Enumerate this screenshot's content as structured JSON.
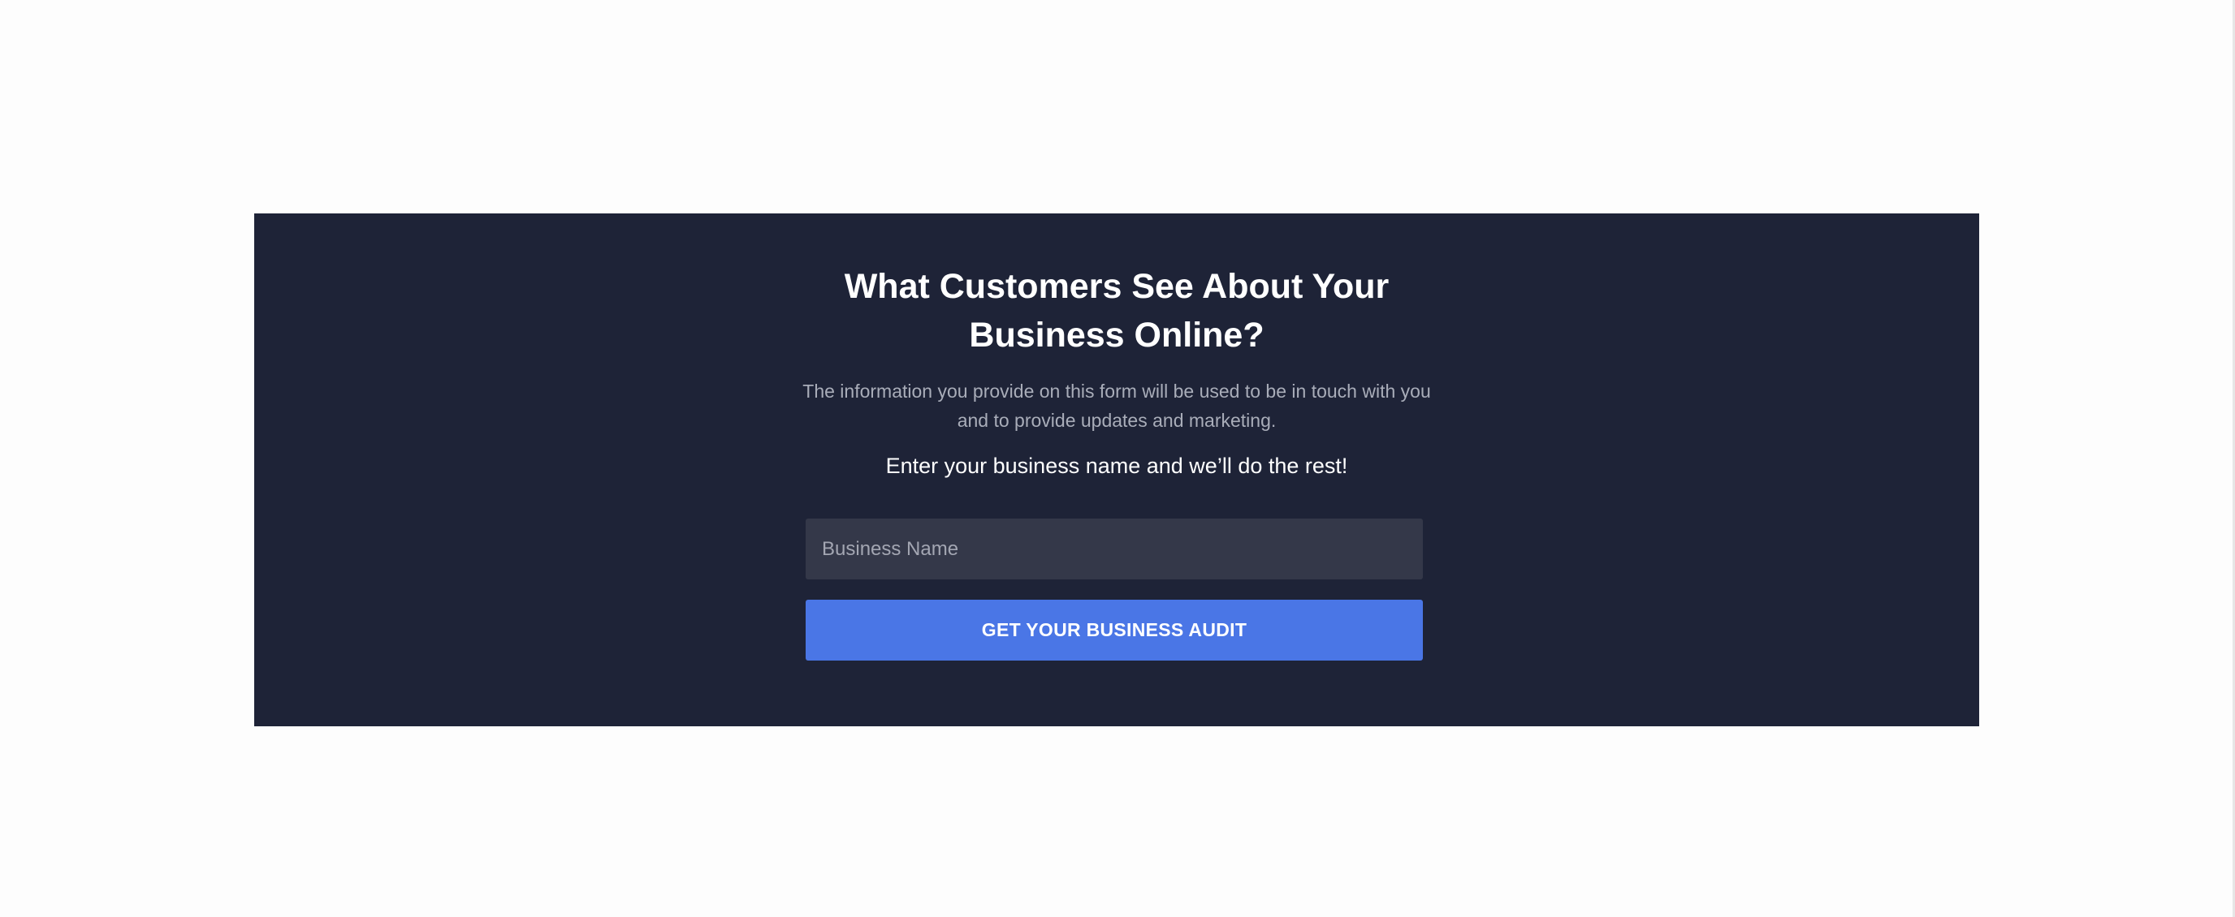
{
  "section": {
    "title": "What Customers See About Your Business Online?",
    "description": "The information you provide on this form will be used to be in touch with you and to provide updates and marketing.",
    "prompt": "Enter your business name and we’ll do the rest!"
  },
  "form": {
    "business_name": {
      "value": "",
      "placeholder": "Business Name"
    },
    "submit_label": "GET YOUR BUSINESS AUDIT"
  },
  "colors": {
    "panel_background": "#1e2337",
    "input_background": "#343849",
    "accent": "#4a76e6",
    "text_primary": "#ffffff",
    "text_muted": "#a9adb9"
  }
}
